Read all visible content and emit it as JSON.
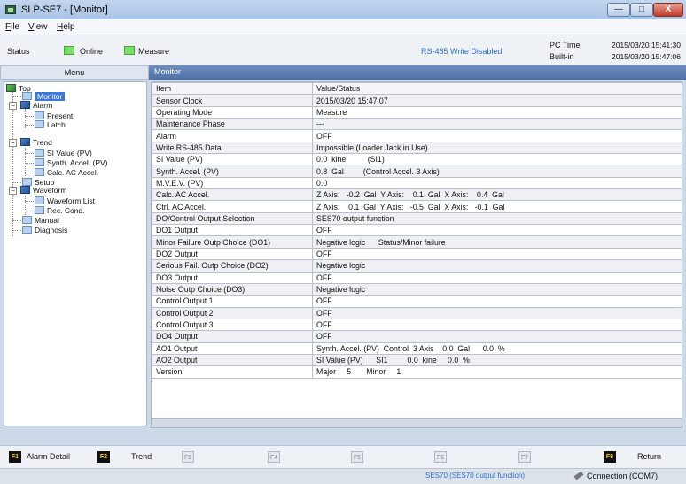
{
  "window": {
    "title": "SLP-SE7 - [Monitor]",
    "min_label": "—",
    "max_label": "□",
    "close_label": "X"
  },
  "menubar": {
    "file": "ile",
    "file_key": "F",
    "view": "iew",
    "view_key": "V",
    "help": "elp",
    "help_key": "H"
  },
  "status": {
    "label": "Status",
    "online": "Online",
    "measure": "Measure",
    "rs485": "RS-485 Write Disabled",
    "pc_time_label": "PC Time",
    "builtin_label": "Built-in",
    "pc_time": "2015/03/20 15:41:30",
    "builtin_time": "2015/03/20 15:47:06",
    "led_color": "#7ee06a"
  },
  "menu_panel": {
    "header": "Menu",
    "tree": {
      "top": "Top",
      "monitor": "Monitor",
      "alarm": "Alarm",
      "present": "Present",
      "latch": "Latch",
      "trend": "Trend",
      "si_value": "SI Value (PV)",
      "synth_accel": "Synth. Accel. (PV)",
      "calc_ac_accel": "Calc. AC Accel.",
      "setup": "Setup",
      "waveform": "Waveform",
      "waveform_list": "Waveform List",
      "rec_cond": "Rec. Cond.",
      "manual": "Manual",
      "diagnosis": "Diagnosis"
    }
  },
  "monitor": {
    "header": "Monitor",
    "columns": [
      "Item",
      "Value/Status"
    ],
    "rows": [
      [
        "Sensor Clock",
        "2015/03/20 15:47:07"
      ],
      [
        "Operating Mode",
        "Measure"
      ],
      [
        "Maintenance Phase",
        "---"
      ],
      [
        "Alarm",
        "OFF"
      ],
      [
        "Write RS-485 Data",
        "Impossible (Loader Jack in Use)"
      ],
      [
        "SI Value (PV)",
        "0.0  kine          (SI1)"
      ],
      [
        "Synth. Accel. (PV)",
        "0.8  Gal         (Control Accel. 3 Axis)"
      ],
      [
        "M.V.E.V. (PV)",
        "0.0"
      ],
      [
        "Calc. AC Accel.",
        "Z Axis:   -0.2  Gal  Y Axis:    0.1  Gal  X Axis:    0.4  Gal"
      ],
      [
        "Ctrl. AC Accel.",
        "Z Axis:    0.1  Gal  Y Axis:   -0.5  Gal  X Axis:   -0.1  Gal"
      ],
      [
        "DO/Control Output Selection",
        "SES70 output function"
      ],
      [
        "DO1 Output",
        "OFF"
      ],
      [
        "Minor Failure Outp Choice (DO1)",
        "Negative logic      Status/Minor failure"
      ],
      [
        "DO2 Output",
        "OFF"
      ],
      [
        "Serious Fail. Outp Choice (DO2)",
        "Negative logic"
      ],
      [
        "DO3 Output",
        "OFF"
      ],
      [
        "Noise Outp Choice (DO3)",
        "Negative logic"
      ],
      [
        "Control Output 1",
        "OFF"
      ],
      [
        "Control Output 2",
        "OFF"
      ],
      [
        "Control Output 3",
        "OFF"
      ],
      [
        "DO4 Output",
        "OFF"
      ],
      [
        "AO1 Output",
        "Synth. Accel. (PV)  Control  3 Axis    0.0  Gal      0.0  %"
      ],
      [
        "AO2 Output",
        "SI Value (PV)      SI1         0.0  kine     0.0  %"
      ],
      [
        "Version",
        "Major     5       Minor     1"
      ]
    ]
  },
  "fkeys": {
    "f1": "F1",
    "f1_label": "Alarm Detail",
    "f2": "F2",
    "f2_label": "Trend",
    "f3": "F3",
    "f4": "F4",
    "f5": "F5",
    "f6": "F6",
    "f7": "F7",
    "f8": "F8",
    "f8_label": "Return"
  },
  "bottom": {
    "function": "SES70 (SES70 output function)",
    "connection": "Connection (COM7)"
  }
}
